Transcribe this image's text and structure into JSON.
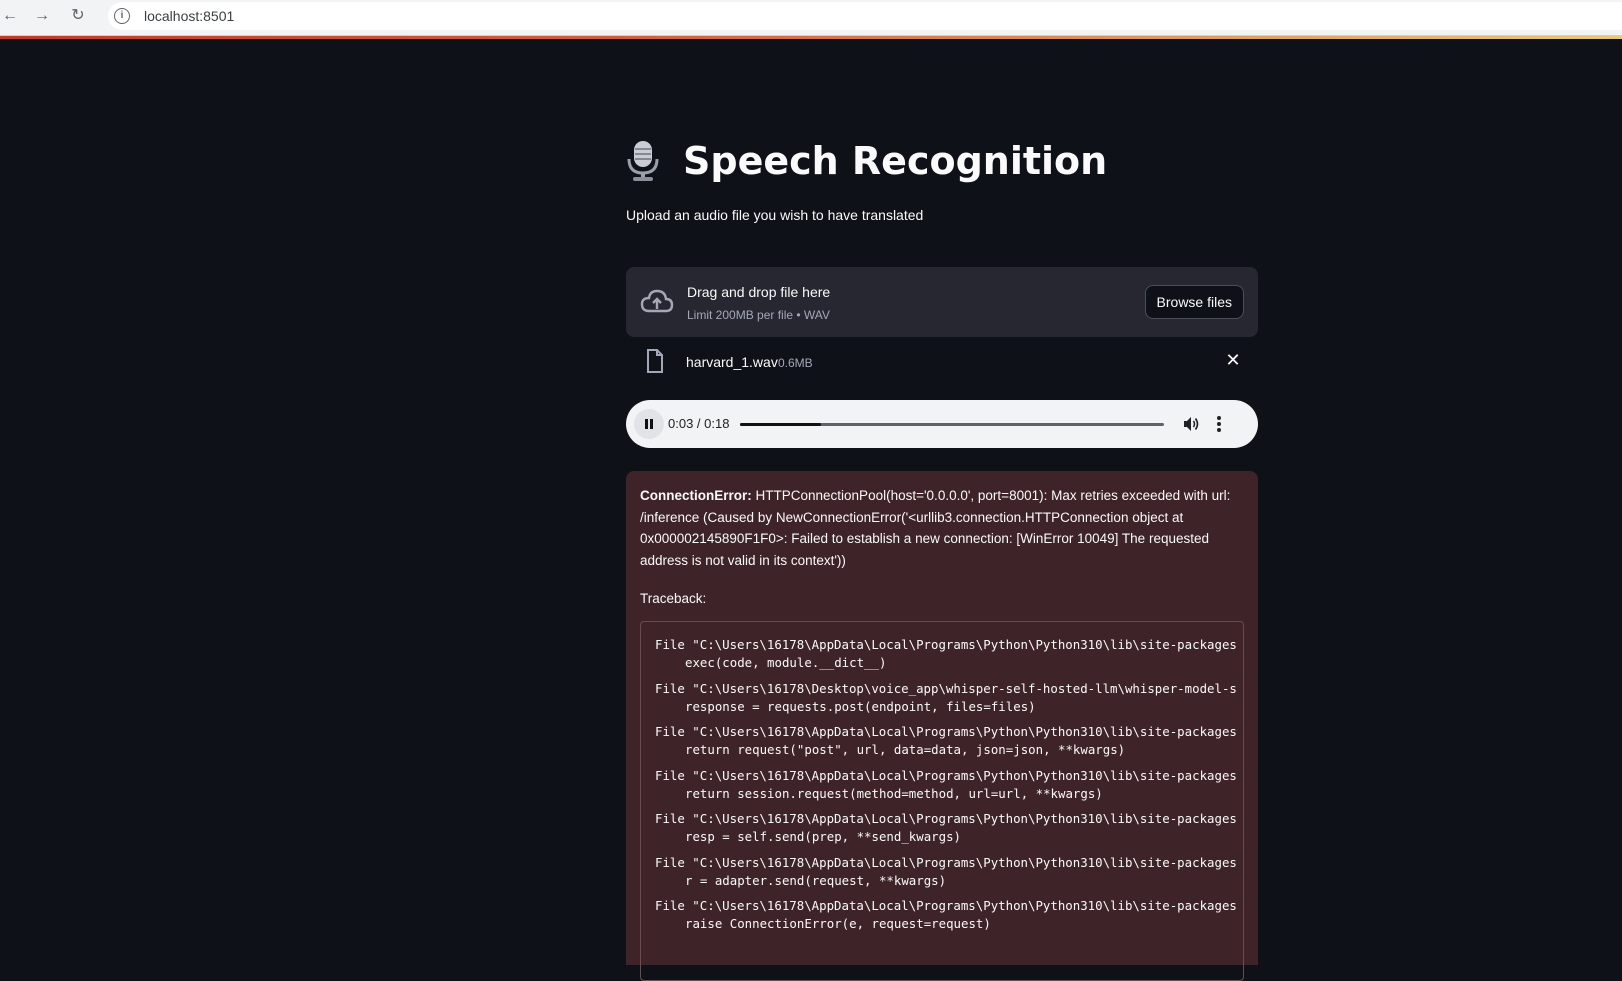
{
  "browser": {
    "url": "localhost:8501",
    "info_icon": "info-icon"
  },
  "header": {
    "title": "Speech Recognition",
    "icon": "microphone-icon",
    "subtitle": "Upload an audio file you wish to have translated"
  },
  "uploader": {
    "drop_text": "Drag and drop file here",
    "limit_text": "Limit 200MB per file • WAV",
    "browse_label": "Browse files"
  },
  "file": {
    "name": "harvard_1.wav",
    "size": "0.6MB"
  },
  "audio": {
    "time": "0:03 / 0:18",
    "progress": 0.19
  },
  "error": {
    "type": "ConnectionError:",
    "message": " HTTPConnectionPool(host='0.0.0.0', port=8001): Max retries exceeded with url: /inference (Caused by NewConnectionError('<urllib3.connection.HTTPConnection object at 0x000002145890F1F0>: Failed to establish a new connection: [WinError 10049] The requested address is not valid in its context'))",
    "traceback_label": "Traceback:",
    "traceback": [
      {
        "file": "File \"C:\\Users\\16178\\AppData\\Local\\Programs\\Python\\Python310\\lib\\site-packages",
        "code": "exec(code, module.__dict__)"
      },
      {
        "file": "File \"C:\\Users\\16178\\Desktop\\voice_app\\whisper-self-hosted-llm\\whisper-model-s",
        "code": "response = requests.post(endpoint, files=files)"
      },
      {
        "file": "File \"C:\\Users\\16178\\AppData\\Local\\Programs\\Python\\Python310\\lib\\site-packages",
        "code": "return request(\"post\", url, data=data, json=json, **kwargs)"
      },
      {
        "file": "File \"C:\\Users\\16178\\AppData\\Local\\Programs\\Python\\Python310\\lib\\site-packages",
        "code": "return session.request(method=method, url=url, **kwargs)"
      },
      {
        "file": "File \"C:\\Users\\16178\\AppData\\Local\\Programs\\Python\\Python310\\lib\\site-packages",
        "code": "resp = self.send(prep, **send_kwargs)"
      },
      {
        "file": "File \"C:\\Users\\16178\\AppData\\Local\\Programs\\Python\\Python310\\lib\\site-packages",
        "code": "r = adapter.send(request, **kwargs)"
      },
      {
        "file": "File \"C:\\Users\\16178\\AppData\\Local\\Programs\\Python\\Python310\\lib\\site-packages",
        "code": "raise ConnectionError(e, request=request)"
      }
    ]
  },
  "colors": {
    "background": "#0e1117",
    "uploader_bg": "#262730",
    "error_bg": "#3e2428"
  }
}
